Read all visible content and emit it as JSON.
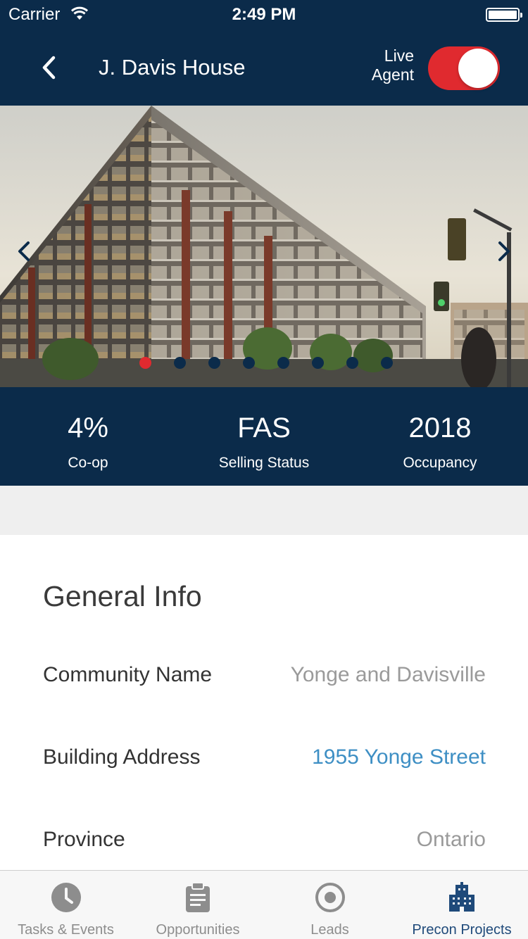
{
  "status_bar": {
    "carrier": "Carrier",
    "time": "2:49 PM"
  },
  "header": {
    "title": "J. Davis House",
    "live_agent_line1": "Live",
    "live_agent_line2": "Agent",
    "live_agent_on": true
  },
  "carousel": {
    "slide_count": 8,
    "active_index": 0
  },
  "stats": [
    {
      "value": "4%",
      "label": "Co-op"
    },
    {
      "value": "FAS",
      "label": "Selling Status"
    },
    {
      "value": "2018",
      "label": "Occupancy"
    }
  ],
  "general_info": {
    "heading": "General Info",
    "rows": [
      {
        "label": "Community Name",
        "value": "Yonge and Davisville"
      },
      {
        "label": "Building Address",
        "value": "1955 Yonge Street"
      },
      {
        "label": "Province",
        "value": "Ontario"
      }
    ]
  },
  "tabs": [
    {
      "label": "Tasks & Events",
      "icon": "clock-icon"
    },
    {
      "label": "Opportunities",
      "icon": "clipboard-icon"
    },
    {
      "label": "Leads",
      "icon": "target-icon"
    },
    {
      "label": "Precon Projects",
      "icon": "building-icon",
      "active": true
    }
  ],
  "colors": {
    "navy": "#0b2b4a",
    "accent_red": "#e02a2f",
    "link_blue": "#3e8fc4"
  }
}
